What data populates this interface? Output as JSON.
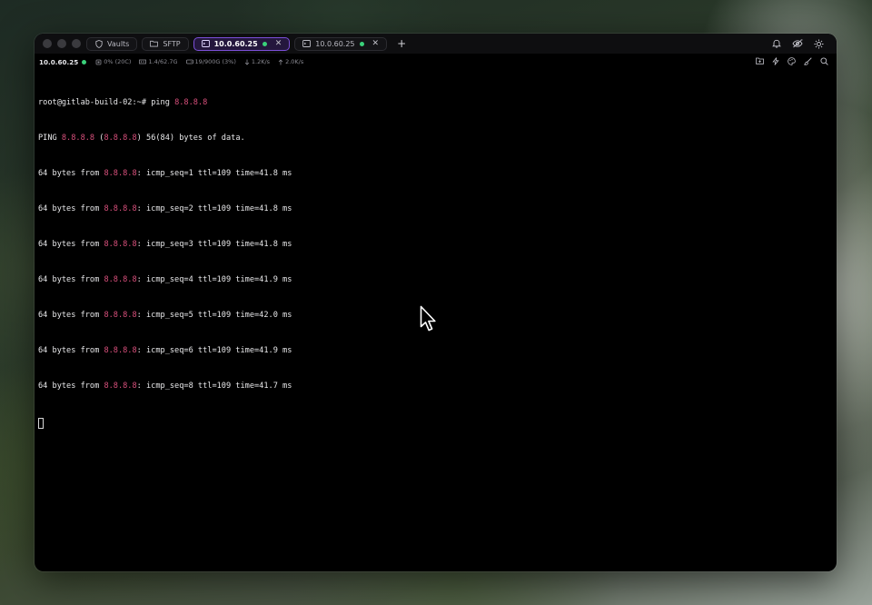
{
  "tabs": [
    {
      "label": "Vaults",
      "icon": "shield-icon",
      "active": false,
      "connected": false,
      "closable": false
    },
    {
      "label": "SFTP",
      "icon": "folder-icon",
      "active": false,
      "connected": false,
      "closable": false
    },
    {
      "label": "10.0.60.25",
      "icon": "terminal-icon",
      "active": true,
      "connected": true,
      "closable": true
    },
    {
      "label": "10.0.60.25",
      "icon": "terminal-icon",
      "active": false,
      "connected": true,
      "closable": true
    }
  ],
  "new_tab_label": "+",
  "titlebar_icons": [
    "bell-icon",
    "eye-off-icon",
    "sun-icon"
  ],
  "status": {
    "host": "10.0.60.25",
    "cpu": "0% (20C)",
    "memory": "1.4/62.7G",
    "disk": "19/900G (3%)",
    "download": "1.2K/s",
    "upload": "2.0K/s"
  },
  "status_icons": [
    "folder-plus-icon",
    "lightning-icon",
    "palette-icon",
    "brush-icon",
    "search-icon"
  ],
  "terminal": {
    "prompt": "root@gitlab-build-02:~# ",
    "command": "ping ",
    "target": "8.8.8.8",
    "header_prefix": "PING ",
    "header_ip": "8.8.8.8",
    "header_open": " (",
    "header_ip2": "8.8.8.8",
    "header_rest": ") 56(84) bytes of data.",
    "reply_prefix": "64 bytes from ",
    "reply_ip": "8.8.8.8",
    "replies": [
      ": icmp_seq=1 ttl=109 time=41.8 ms",
      ": icmp_seq=2 ttl=109 time=41.8 ms",
      ": icmp_seq=3 ttl=109 time=41.8 ms",
      ": icmp_seq=4 ttl=109 time=41.9 ms",
      ": icmp_seq=5 ttl=109 time=42.0 ms",
      ": icmp_seq=6 ttl=109 time=41.9 ms",
      ": icmp_seq=8 ttl=109 time=41.7 ms"
    ]
  },
  "colors": {
    "accent": "#7b4fd8",
    "ip_highlight": "#d9507c",
    "connected": "#3ad17a"
  }
}
